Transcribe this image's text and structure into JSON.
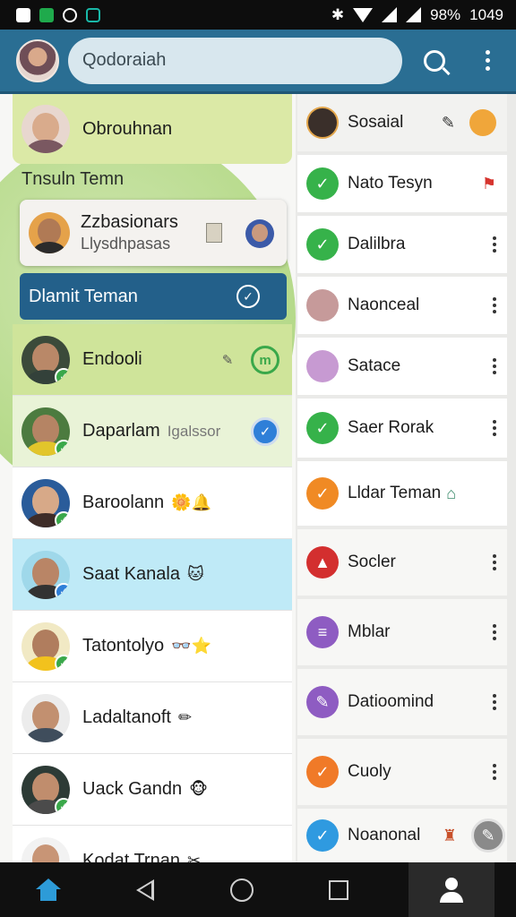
{
  "status_bar": {
    "battery": "98%",
    "time": "1049"
  },
  "search": {
    "placeholder": "Qodoraiah"
  },
  "profile": {
    "name": "Obrouhnan"
  },
  "section_title": "Tnsuln Temn",
  "popup": {
    "title": "Zzbasionars",
    "subtitle": "Llysdhpasas"
  },
  "cta": {
    "label": "Dlamit Teman"
  },
  "contacts": [
    {
      "name": "Endooli",
      "sub": "",
      "emoji": ""
    },
    {
      "name": "Daparlam",
      "sub": "Igalssor",
      "emoji": ""
    },
    {
      "name": "Baroolann",
      "sub": "",
      "emoji": "🌼🔔"
    },
    {
      "name": "Saat Kanala",
      "sub": "",
      "emoji": "🐱"
    },
    {
      "name": "Tatontolyo",
      "sub": "",
      "emoji": "👓⭐"
    },
    {
      "name": "Ladaltanoft",
      "sub": "",
      "emoji": "✏"
    },
    {
      "name": "Uack Gandn",
      "sub": "",
      "emoji": "🐵"
    },
    {
      "name": "Kodat Trnan",
      "sub": "",
      "emoji": "✂"
    }
  ],
  "groups": [
    {
      "label": "Sosaial",
      "color": "#3a2f2a"
    },
    {
      "label": "Nato Tesyn",
      "color": "#36b24a"
    },
    {
      "label": "Dalilbra",
      "color": "#36b24a"
    },
    {
      "label": "Naonceal",
      "color": "#c69a9a"
    },
    {
      "label": "Satace",
      "color": "#c79ad2"
    },
    {
      "label": "Saer Rorak",
      "color": "#36b24a"
    },
    {
      "label": "Lldar Teman",
      "color": "#f08a24"
    },
    {
      "label": "Socler",
      "color": "#d32f2f"
    },
    {
      "label": "Mblar",
      "color": "#8e5cc2"
    },
    {
      "label": "Datioomind",
      "color": "#8e5cc2"
    },
    {
      "label": "Cuoly",
      "color": "#f07a28"
    },
    {
      "label": "Noanonal",
      "color": "#2f9ae0"
    }
  ]
}
